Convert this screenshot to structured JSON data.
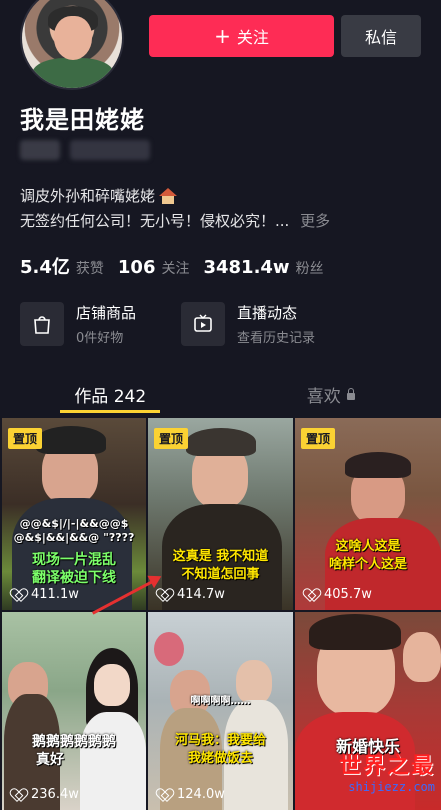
{
  "profile": {
    "name": "我是田姥姥",
    "follow_label": "关注",
    "message_label": "私信",
    "bio_line1": "调皮外孙和碎嘴姥姥",
    "bio_line2": "无签约任何公司！无小号！侵权必究！...",
    "more_label": "更多"
  },
  "stats": [
    {
      "value": "5.4亿",
      "label": "获赞"
    },
    {
      "value": "106",
      "label": "关注"
    },
    {
      "value": "3481.4w",
      "label": "粉丝"
    }
  ],
  "cards": [
    {
      "title": "店铺商品",
      "subtitle": "0件好物",
      "icon": "shopping-bag-icon"
    },
    {
      "title": "直播动态",
      "subtitle": "查看历史记录",
      "icon": "live-tv-icon"
    }
  ],
  "tabs": [
    {
      "label": "作品 242"
    },
    {
      "label": "喜欢"
    }
  ],
  "videos": [
    {
      "pinned": "置顶",
      "likes": "411.1w",
      "caption1": "@@&$|/|-|&&@@$",
      "caption2": "@&$|&&|&&@ \"????",
      "caption3": "现场一片混乱",
      "caption4": "翻译被迫下线"
    },
    {
      "pinned": "置顶",
      "likes": "414.7w",
      "caption1": "这真是 我不知道",
      "caption2": "不知道怎回事"
    },
    {
      "pinned": "置顶",
      "likes": "405.7w",
      "caption1": "这啥人这是",
      "caption2": "啥样个人这是"
    },
    {
      "likes": "236.4w",
      "caption1": "鹅鹅鹅鹅鹅鹅",
      "caption2": "真好"
    },
    {
      "likes": "124.0w",
      "caption1": "啊啊啊啊……",
      "caption2": "河马我：我要给",
      "caption3": "我姥做饭去"
    },
    {
      "likes": "",
      "caption1": "新婚快乐"
    }
  ],
  "watermark": {
    "title": "世界之最",
    "url": "shijiezz.com"
  },
  "colors": {
    "accent": "#fe2c55",
    "tab_indicator": "#fbd233",
    "background": "#161722"
  }
}
